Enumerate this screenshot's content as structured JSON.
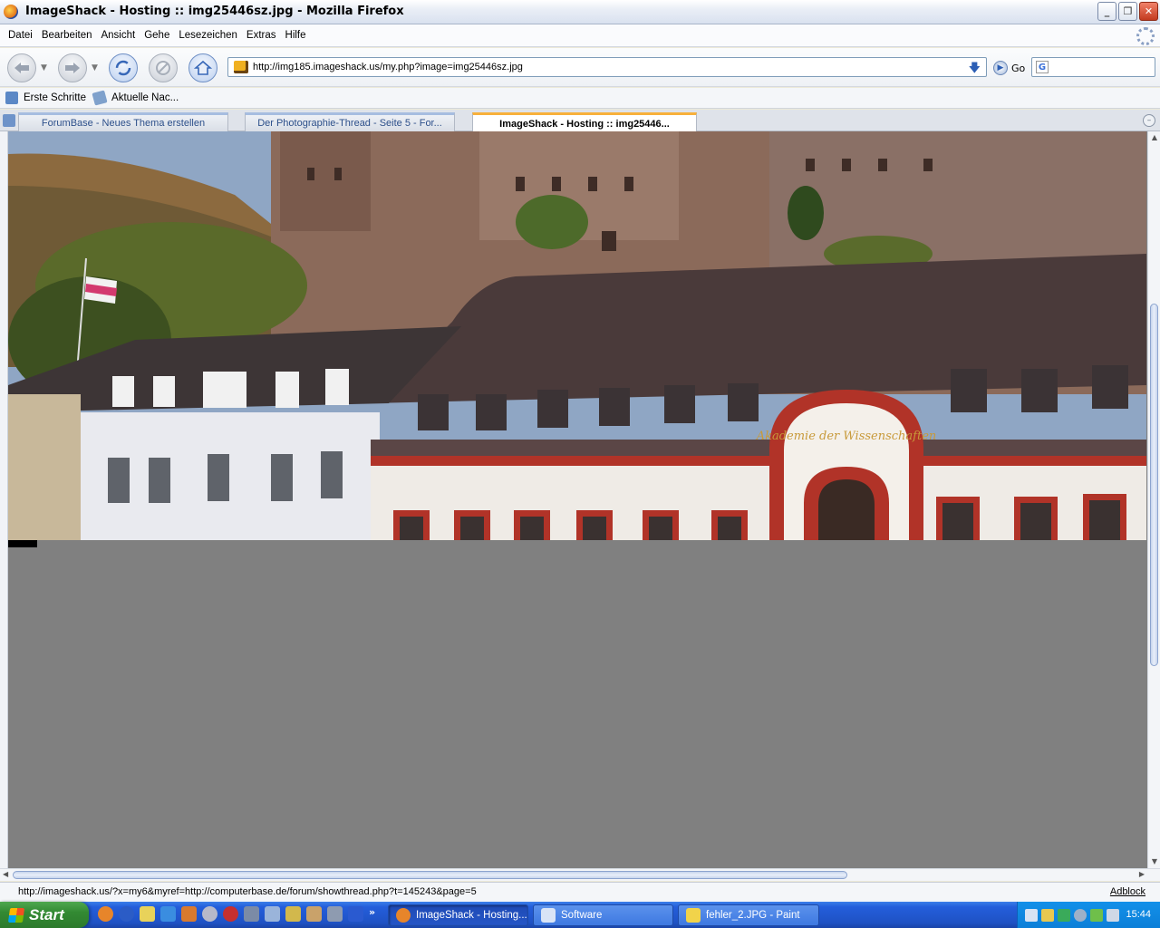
{
  "window": {
    "title": "ImageShack - Hosting :: img25446sz.jpg - Mozilla Firefox",
    "buttons": {
      "minimize": "_",
      "maximize": "❐",
      "close": "✕"
    }
  },
  "menu": {
    "items": [
      "Datei",
      "Bearbeiten",
      "Ansicht",
      "Gehe",
      "Lesezeichen",
      "Extras",
      "Hilfe"
    ]
  },
  "nav": {
    "back_icon": "back-arrow-icon",
    "forward_icon": "forward-arrow-icon",
    "reload_icon": "reload-icon",
    "stop_icon": "stop-icon",
    "home_icon": "home-icon",
    "url": "http://img185.imageshack.us/my.php?image=img25446sz.jpg",
    "go_label": "Go",
    "search_engine": "G"
  },
  "bookmarks": {
    "items": [
      {
        "label": "Erste Schritte",
        "icon": "bookmark-page-icon"
      },
      {
        "label": "Aktuelle Nac...",
        "icon": "rss-feed-icon"
      }
    ]
  },
  "tabs": {
    "items": [
      {
        "label": "ForumBase - Neues Thema erstellen",
        "active": false
      },
      {
        "label": "Der Photographie-Thread - Seite 5 - For...",
        "active": false
      },
      {
        "label": "ImageShack - Hosting :: img25446...",
        "active": true
      }
    ],
    "close_glyph": "–"
  },
  "content": {
    "image_alt": "Photo of Heidelberg castle above buildings, including the Akademie der Wissenschaften",
    "facade_text": "Akademie der Wissenschaften",
    "background_color": "#808080"
  },
  "status": {
    "text": "http://imageshack.us/?x=my6&myref=http://computerbase.de/forum/showthread.php?t=145243&page=5",
    "adblock": "Adblock"
  },
  "taskbar": {
    "start_label": "Start",
    "more_glyph": "»",
    "tasks": [
      {
        "label": "ImageShack - Hosting...",
        "active": true,
        "icon_color": "#e7852a"
      },
      {
        "label": "Software",
        "active": false,
        "icon_color": "#d9e4f6"
      },
      {
        "label": "fehler_2.JPG - Paint",
        "active": false,
        "icon_color": "#f1d34a"
      }
    ],
    "clock": "15:44"
  },
  "colors": {
    "window_chrome": "#ece9d8",
    "taskbar_blue": "#245edb",
    "start_green": "#338a33",
    "active_tab_accent": "#f7b03c"
  }
}
